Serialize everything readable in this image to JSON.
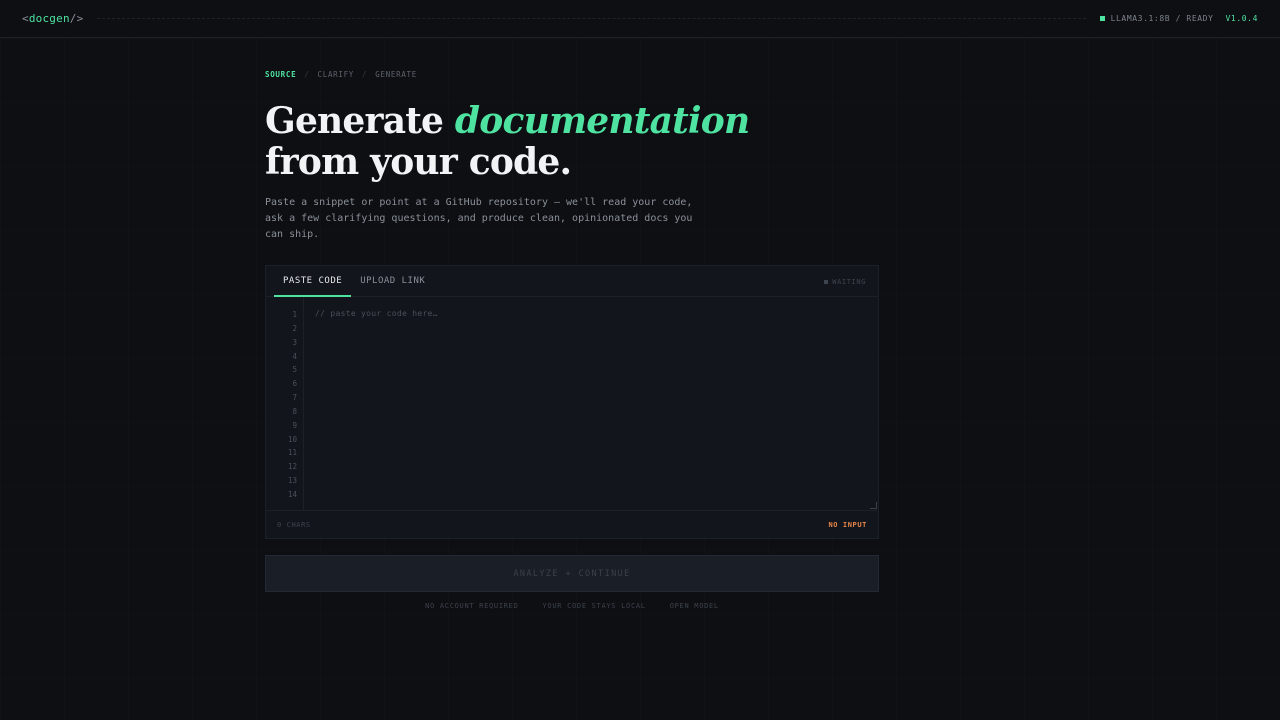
{
  "header": {
    "logo_open": "<",
    "logo_name": "docgen",
    "logo_close": "/>",
    "model_status": "LLAMA3.1:8B / READY",
    "version": "V1.0.4"
  },
  "steps": [
    {
      "label": "SOURCE",
      "active": true
    },
    {
      "label": "CLARIFY",
      "active": false
    },
    {
      "label": "GENERATE",
      "active": false
    }
  ],
  "steps_separator": "/",
  "hero": {
    "title_part1": "Generate ",
    "title_highlight": "documentation",
    "title_part2": "from your code.",
    "lead": "Paste a snippet or point at a GitHub repository — we'll read your code, ask a few clarifying questions, and produce clean, opinionated docs you can ship."
  },
  "editor": {
    "tabs": [
      {
        "label": "PASTE CODE",
        "active": true
      },
      {
        "label": "UPLOAD LINK",
        "active": false
      }
    ],
    "state": "WAITING",
    "placeholder": "// paste your code here…",
    "line_numbers": [
      "1",
      "2",
      "3",
      "4",
      "5",
      "6",
      "7",
      "8",
      "9",
      "10",
      "11",
      "12",
      "13",
      "14"
    ],
    "char_count": "0 CHARS",
    "input_status": "NO INPUT"
  },
  "actions": {
    "analyze_label": "ANALYZE + CONTINUE"
  },
  "trust": [
    "NO ACCOUNT REQUIRED",
    "YOUR CODE STAYS LOCAL",
    "OPEN MODEL"
  ],
  "colors": {
    "accent": "#4fe3a1",
    "warning": "#e8874a",
    "background": "#0d0f13"
  }
}
